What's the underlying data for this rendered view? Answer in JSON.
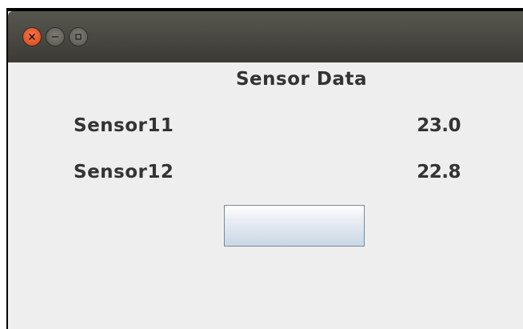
{
  "window": {
    "title": "",
    "controls": [
      "close-icon",
      "minimize-icon",
      "maximize-icon"
    ],
    "colors": {
      "titlebar": "#3c3b37",
      "close": "#e2522a",
      "body": "#eeeeee"
    }
  },
  "main": {
    "heading": "Sensor Data",
    "sensors": [
      {
        "label": "Sensor11",
        "value": "23.0"
      },
      {
        "label": "Sensor12",
        "value": "22.8"
      }
    ],
    "button_label": ""
  }
}
